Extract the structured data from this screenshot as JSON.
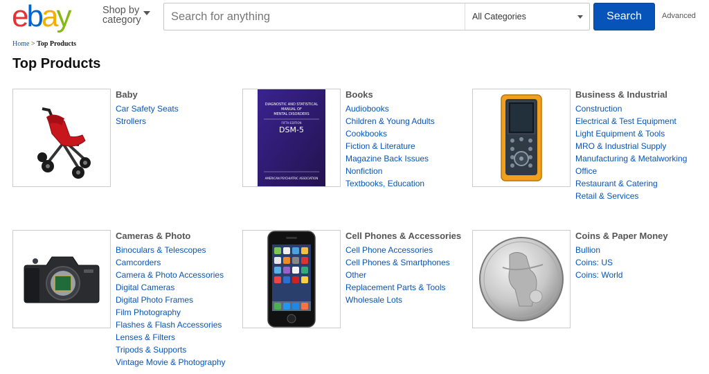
{
  "header": {
    "logo_text": "ebay",
    "shop_by_line1": "Shop by",
    "shop_by_line2": "category",
    "search_placeholder": "Search for anything",
    "category_selected": "All Categories",
    "search_button": "Search",
    "advanced_link": "Advanced"
  },
  "breadcrumb": {
    "home": "Home",
    "separator": " > ",
    "current": "Top Products"
  },
  "page_title": "Top Products",
  "categories": [
    {
      "title": "Baby",
      "image": "stroller-image",
      "links": [
        "Car Safety Seats",
        "Strollers"
      ]
    },
    {
      "title": "Books",
      "image": "dsm5-book-image",
      "links": [
        "Audiobooks",
        "Children & Young Adults",
        "Cookbooks",
        "Fiction & Literature",
        "Magazine Back Issues",
        "Nonfiction",
        "Textbooks, Education"
      ]
    },
    {
      "title": "Business & Industrial",
      "image": "multimeter-image",
      "links": [
        "Construction",
        "Electrical & Test Equipment",
        "Light Equipment & Tools",
        "MRO & Industrial Supply",
        "Manufacturing & Metalworking Office",
        "Restaurant & Catering",
        "Retail & Services"
      ]
    },
    {
      "title": "Cameras & Photo",
      "image": "dslr-camera-image",
      "links": [
        "Binoculars & Telescopes",
        "Camcorders",
        "Camera & Photo Accessories",
        "Digital Cameras",
        "Digital Photo Frames",
        "Film Photography",
        "Flashes & Flash Accessories",
        "Lenses & Filters",
        "Tripods & Supports",
        "Vintage Movie & Photography"
      ]
    },
    {
      "title": "Cell Phones & Accessories",
      "image": "smartphone-image",
      "links": [
        "Cell Phone Accessories",
        "Cell Phones & Smartphones",
        "Other",
        "Replacement Parts & Tools",
        "Wholesale Lots"
      ]
    },
    {
      "title": "Coins & Paper Money",
      "image": "silver-coin-image",
      "links": [
        "Bullion",
        "Coins: US",
        "Coins: World"
      ]
    }
  ],
  "book_cover": {
    "line1": "DIAGNOSTIC AND STATISTICAL",
    "line2": "MANUAL OF",
    "line3": "MENTAL DISORDERS",
    "edition": "FIFTH EDITION",
    "title": "DSM-5",
    "publisher": "AMERICAN PSYCHIATRIC ASSOCIATION"
  },
  "colors": {
    "logo_e": "#e53238",
    "logo_b": "#0064d2",
    "logo_a": "#f5af02",
    "logo_y": "#86b817",
    "link": "#0654ba",
    "button": "#0654ba"
  }
}
